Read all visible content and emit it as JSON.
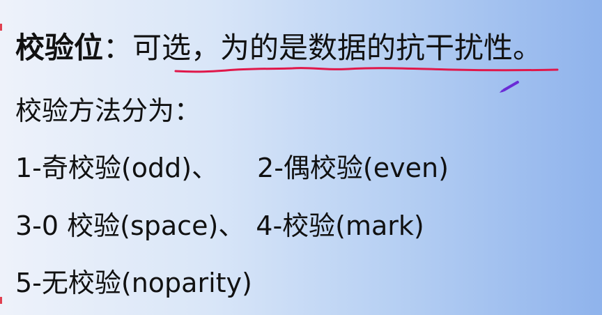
{
  "slide": {
    "line1": {
      "term": "校验位",
      "colon": "：",
      "text": "可选，为的是数据的抗干扰性。"
    },
    "line2": {
      "text": "校验方法分为："
    },
    "line3": {
      "left": "1-奇校验(odd)、",
      "right": "2-偶校验(even)"
    },
    "line4": {
      "left": "3-0 校验(space)、",
      "right": "4-校验(mark)"
    },
    "line5": {
      "text": "5-无校验(noparity)"
    }
  },
  "colors": {
    "text": "#111111",
    "annotation_underline": "#e0174a",
    "pen_cursor": "#6a2bd6",
    "edge_marks": "#e04050"
  }
}
